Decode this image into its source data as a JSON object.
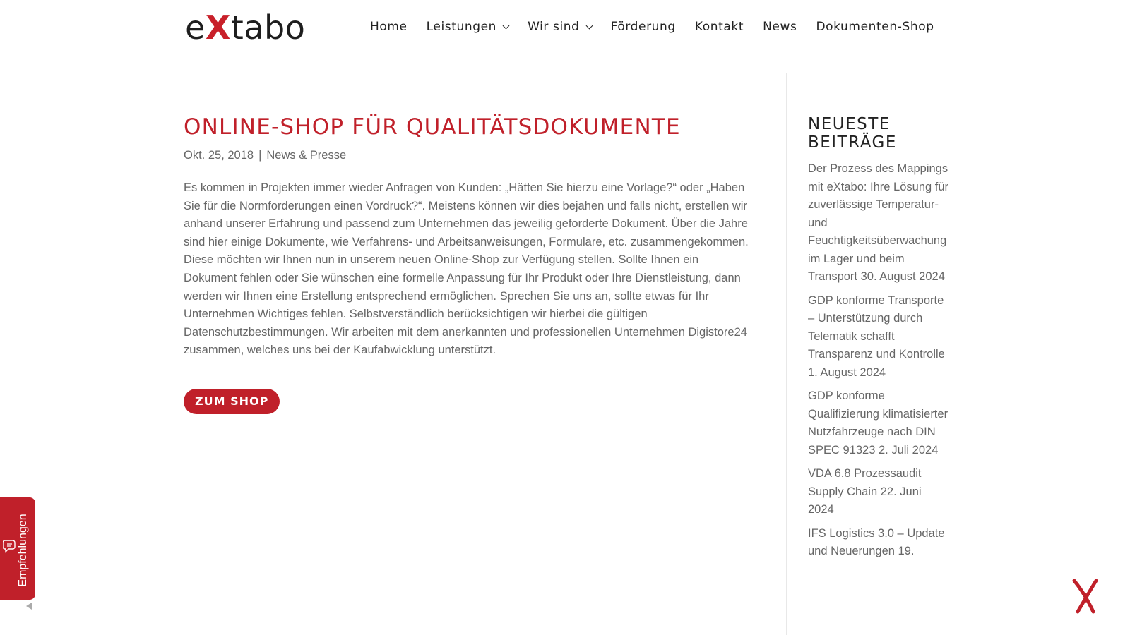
{
  "brand": {
    "logo_pre": "e",
    "logo_x": "X",
    "logo_post": "tabo",
    "accent_color": "#c0202a"
  },
  "nav": {
    "items": [
      {
        "label": "Home",
        "has_dropdown": false
      },
      {
        "label": "Leistungen",
        "has_dropdown": true
      },
      {
        "label": "Wir sind",
        "has_dropdown": true
      },
      {
        "label": "Förderung",
        "has_dropdown": false
      },
      {
        "label": "Kontakt",
        "has_dropdown": false
      },
      {
        "label": "News",
        "has_dropdown": false
      },
      {
        "label": "Dokumenten-Shop",
        "has_dropdown": false
      }
    ]
  },
  "post": {
    "title": "ONLINE-SHOP FÜR QUALITÄTSDOKUMENTE",
    "date": "Okt. 25, 2018",
    "separator": "|",
    "category": "News & Presse",
    "body": "Es kommen in Projekten immer wieder Anfragen von Kunden: „Hätten Sie hierzu eine Vorlage?“ oder „Haben Sie für die Normforderungen einen Vordruck?“. Meistens können wir dies bejahen und falls nicht, erstellen wir anhand unserer Erfahrung und passend zum Unternehmen das jeweilig geforderte Dokument. Über die Jahre sind hier einige Dokumente, wie Verfahrens- und Arbeitsanweisungen, Formulare, etc. zusammengekommen. Diese möchten wir Ihnen nun in unserem neuen Online-Shop zur Verfügung stellen. Sollte Ihnen ein Dokument fehlen oder Sie wünschen eine formelle Anpassung für Ihr Produkt oder Ihre Dienstleistung, dann werden wir Ihnen eine Erstellung entsprechend ermöglichen. Sprechen Sie uns an, sollte etwas für Ihr Unternehmen Wichtiges fehlen. Selbstverständlich berücksichtigen wir hierbei die gültigen Datenschutzbestimmungen. Wir arbeiten mit dem anerkannten und professionellen Unternehmen Digistore24 zusammen, welches uns bei der Kaufabwicklung unterstützt.",
    "button_label": "ZUM SHOP"
  },
  "sidebar": {
    "title": "NEUESTE BEITRÄGE",
    "posts": [
      {
        "title": "Der Prozess des Mappings mit eXtabo: Ihre Lösung für zuverlässige Temperatur- und Feuchtigkeitsüberwachung im Lager und beim Transport",
        "date": "30. August 2024"
      },
      {
        "title": "GDP konforme Transporte – Unterstützung durch Telematik schafft Transparenz und Kontrolle",
        "date": "1. August 2024"
      },
      {
        "title": "GDP konforme Qualifizierung klimatisierter Nutzfahrzeuge nach DIN SPEC 91323",
        "date": "2. Juli 2024"
      },
      {
        "title": "VDA 6.8 Prozessaudit Supply Chain",
        "date": "22. Juni 2024"
      },
      {
        "title": "IFS Logistics 3.0 – Update und Neuerungen",
        "date": "19."
      }
    ]
  },
  "widget": {
    "label": "Empfehlungen",
    "icon": "chat-bubbles-icon",
    "collapse_icon": "caret-left-icon"
  },
  "floating": {
    "icon": "extabo-x-icon"
  }
}
